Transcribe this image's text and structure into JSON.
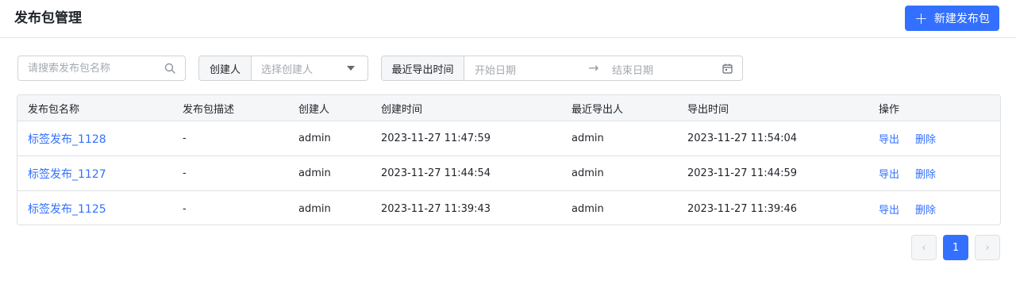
{
  "header": {
    "title": "发布包管理",
    "create_button": "新建发布包"
  },
  "filters": {
    "search_placeholder": "请搜索发布包名称",
    "creator_label": "创建人",
    "creator_placeholder": "选择创建人",
    "date_label": "最近导出时间",
    "start_placeholder": "开始日期",
    "end_placeholder": "结束日期"
  },
  "table": {
    "columns": [
      "发布包名称",
      "发布包描述",
      "创建人",
      "创建时间",
      "最近导出人",
      "导出时间",
      "操作"
    ],
    "rows": [
      {
        "name": "标签发布_1128",
        "desc": "-",
        "creator": "admin",
        "created": "2023-11-27 11:47:59",
        "exporter": "admin",
        "exported": "2023-11-27 11:54:04"
      },
      {
        "name": "标签发布_1127",
        "desc": "-",
        "creator": "admin",
        "created": "2023-11-27 11:44:54",
        "exporter": "admin",
        "exported": "2023-11-27 11:44:59"
      },
      {
        "name": "标签发布_1125",
        "desc": "-",
        "creator": "admin",
        "created": "2023-11-27 11:39:43",
        "exporter": "admin",
        "exported": "2023-11-27 11:39:46"
      }
    ],
    "actions": {
      "export": "导出",
      "delete": "删除"
    }
  },
  "pagination": {
    "prev": "‹",
    "current": "1",
    "next": "›"
  },
  "icons": {
    "search": "search-icon",
    "caret": "caret-down-icon",
    "arrow": "arrow-right-icon",
    "calendar": "calendar-icon",
    "plus": "plus-icon"
  },
  "colors": {
    "primary": "#3370ff",
    "border": "#dee0e3",
    "header_bg": "#f5f6f7"
  }
}
